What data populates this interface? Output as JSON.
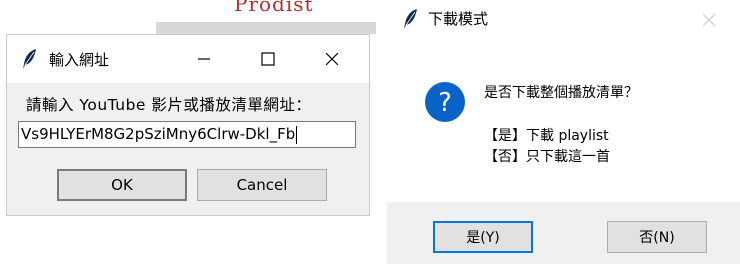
{
  "background": {
    "text": "Prodist"
  },
  "input_dialog": {
    "title": "輸入網址",
    "prompt": "請輸入 YouTube 影片或播放清單網址：",
    "url_value": "Vs9HLYErM8G2pSziMny6Clrw-Dkl_Fb",
    "ok_label": "OK",
    "cancel_label": "Cancel",
    "icons": [
      "feather-icon",
      "minimize-icon",
      "maximize-icon",
      "close-icon"
    ]
  },
  "download_dialog": {
    "title": "下載模式",
    "question": "是否下載整個播放清單？",
    "option_yes": "【是】下載 playlist",
    "option_no": "【否】只下載這一首",
    "yes_label": "是(Y)",
    "no_label": "否(N)",
    "icons": [
      "feather-icon",
      "close-icon",
      "question-icon"
    ],
    "accent_color": "#0a64c8"
  }
}
